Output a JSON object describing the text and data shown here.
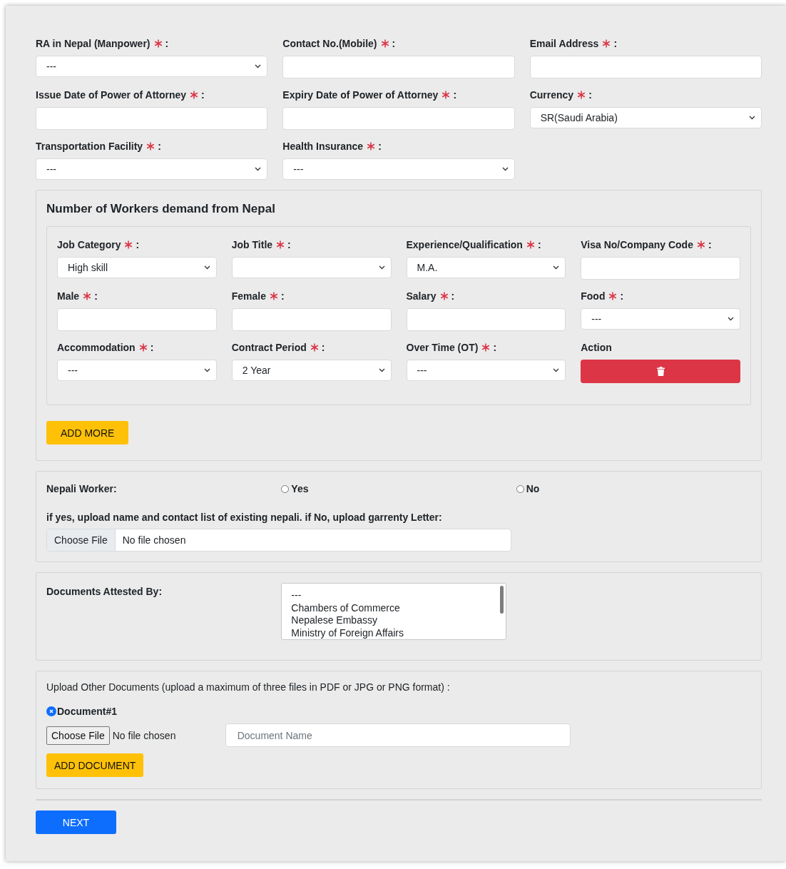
{
  "top_fields": [
    {
      "label": "RA in Nepal (Manpower)",
      "required": true,
      "suffix": ":",
      "kind": "select",
      "value": "---"
    },
    {
      "label": "Contact No.(Mobile)",
      "required": true,
      "suffix": ":",
      "kind": "text"
    },
    {
      "label": "Email Address",
      "required": true,
      "suffix": ":",
      "kind": "text"
    },
    {
      "label": "Issue Date of Power of Attorney",
      "required": true,
      "suffix": ":",
      "kind": "text"
    },
    {
      "label": "Expiry Date of Power of Attorney",
      "required": true,
      "suffix": ":",
      "kind": "text"
    },
    {
      "label": "Currency",
      "required": true,
      "suffix": ":",
      "kind": "select",
      "value": "SR(Saudi Arabia)"
    },
    {
      "label": "Transportation Facility",
      "required": true,
      "suffix": ":",
      "kind": "select",
      "value": "---"
    },
    {
      "label": "Health Insurance",
      "required": true,
      "suffix": ":",
      "kind": "select",
      "value": "---"
    }
  ],
  "workers": {
    "title": "Number of Workers demand from Nepal",
    "fields": [
      {
        "label": "Job Category",
        "required": true,
        "suffix": ":",
        "kind": "select",
        "value": "High skill"
      },
      {
        "label": "Job Title",
        "required": true,
        "suffix": ":",
        "kind": "select"
      },
      {
        "label": "Experience/Qualification",
        "required": true,
        "suffix": ":",
        "kind": "select",
        "value": "M.A."
      },
      {
        "label": "Visa No/Company Code",
        "required": true,
        "suffix": ":",
        "kind": "text"
      },
      {
        "label": "Male",
        "required": true,
        "suffix": ":",
        "kind": "text"
      },
      {
        "label": "Female",
        "required": true,
        "suffix": ":",
        "kind": "text"
      },
      {
        "label": "Salary",
        "required": true,
        "suffix": ":",
        "kind": "text"
      },
      {
        "label": "Food",
        "required": true,
        "suffix": ":",
        "kind": "select",
        "value": "---"
      },
      {
        "label": "Accommodation",
        "required": true,
        "suffix": ":",
        "kind": "select",
        "value": "---"
      },
      {
        "label": "Contract Period",
        "required": true,
        "suffix": ":",
        "kind": "select",
        "value": "2 Year"
      },
      {
        "label": "Over Time (OT)",
        "required": true,
        "suffix": ":",
        "kind": "select",
        "value": "---"
      },
      {
        "label": "Action",
        "required": false,
        "kind": "delete"
      }
    ],
    "add_button": "ADD MORE"
  },
  "nepali_worker": {
    "label": "Nepali Worker:",
    "options": [
      {
        "label": "Yes",
        "selected": false
      },
      {
        "label": "No",
        "selected": false
      }
    ],
    "upload_label": "if yes, upload name and contact list of existing nepali. if No, upload garrenty Letter:",
    "file_button": "Choose File",
    "file_status": "No file chosen"
  },
  "attested": {
    "label": "Documents Attested By:",
    "options": [
      "---",
      "Chambers of Commerce",
      "Nepalese Embassy",
      "Ministry of Foreign Affairs"
    ]
  },
  "other_documents": {
    "label": "Upload Other Documents (upload a maximum of three files in PDF or JPG or PNG format) :",
    "documents": [
      {
        "title": "Document#1",
        "file_button": "Choose File",
        "file_status": "No file chosen",
        "name_placeholder": "Document Name"
      }
    ],
    "add_button": "ADD DOCUMENT"
  },
  "next_button": "NEXT"
}
